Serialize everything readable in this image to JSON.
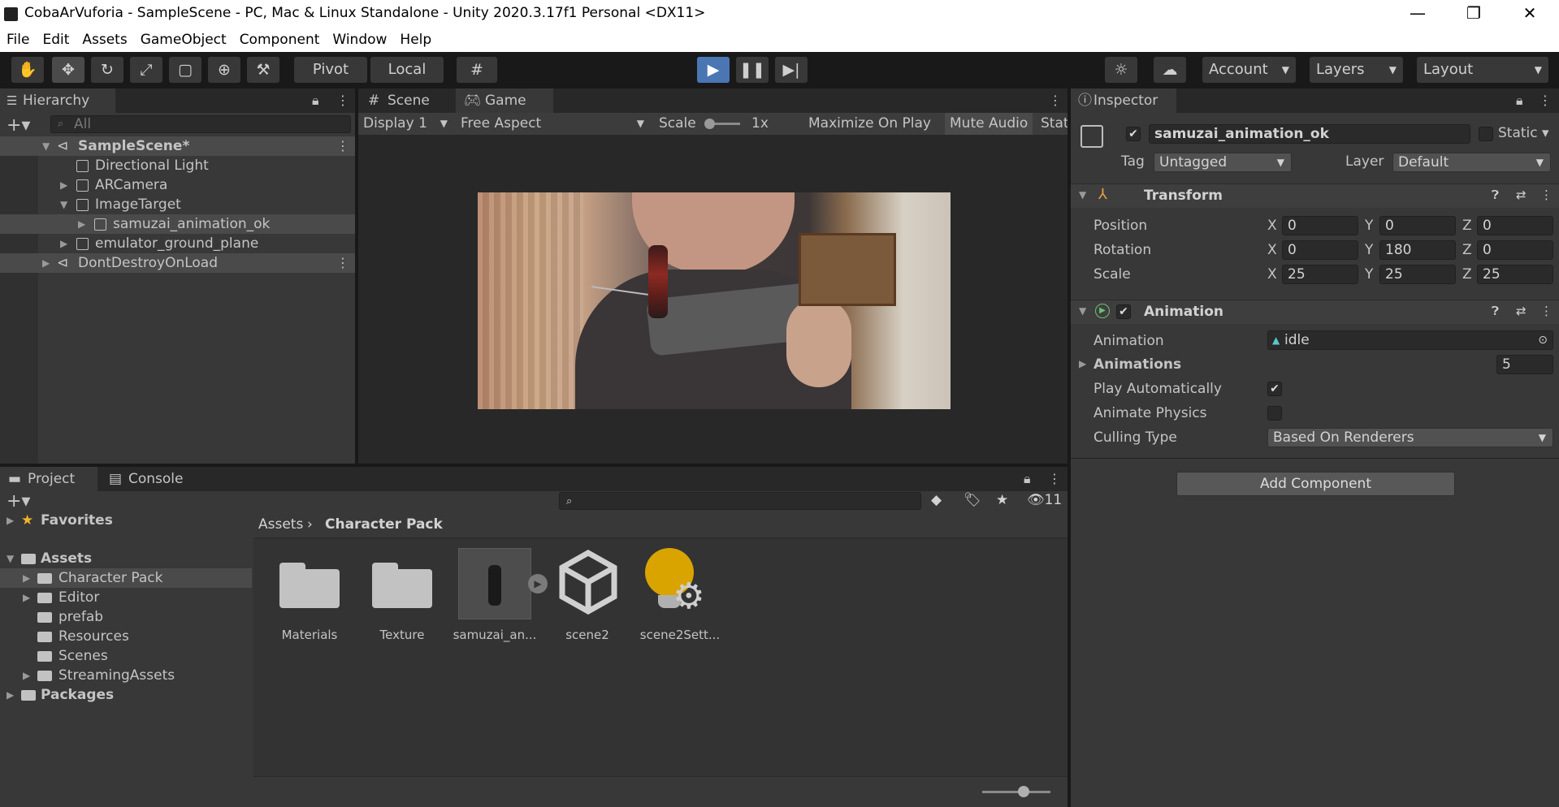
{
  "window": {
    "title": "CobaArVuforia - SampleScene - PC, Mac & Linux Standalone - Unity 2020.3.17f1 Personal <DX11>"
  },
  "menu": [
    "File",
    "Edit",
    "Assets",
    "GameObject",
    "Component",
    "Window",
    "Help"
  ],
  "toolbar": {
    "pivot": "Pivot",
    "local": "Local",
    "account": "Account",
    "layers": "Layers",
    "layout": "Layout"
  },
  "hierarchy": {
    "tab": "Hierarchy",
    "search_placeholder": "All",
    "items": [
      "SampleScene*",
      "Directional Light",
      "ARCamera",
      "ImageTarget",
      "samuzai_animation_ok",
      "emulator_ground_plane",
      "DontDestroyOnLoad"
    ]
  },
  "game": {
    "tabs": [
      "Scene",
      "Game"
    ],
    "display": "Display 1",
    "aspect": "Free Aspect",
    "scale_label": "Scale",
    "scale_value": "1x",
    "maximize": "Maximize On Play",
    "mute": "Mute Audio",
    "stats": "Stat"
  },
  "inspector": {
    "tab": "Inspector",
    "object_name": "samuzai_animation_ok",
    "static": "Static",
    "tag_label": "Tag",
    "tag_value": "Untagged",
    "layer_label": "Layer",
    "layer_value": "Default",
    "transform": {
      "title": "Transform",
      "position_label": "Position",
      "rotation_label": "Rotation",
      "scale_label": "Scale",
      "position": [
        "0",
        "0",
        "0"
      ],
      "rotation": [
        "0",
        "180",
        "0"
      ],
      "scale": [
        "25",
        "25",
        "25"
      ],
      "axes": [
        "X",
        "Y",
        "Z"
      ]
    },
    "animation": {
      "title": "Animation",
      "animation_label": "Animation",
      "animation_value": "idle",
      "animations_label": "Animations",
      "animations_count": "5",
      "play_auto_label": "Play Automatically",
      "animate_physics_label": "Animate Physics",
      "culling_label": "Culling Type",
      "culling_value": "Based On Renderers"
    },
    "add_component": "Add Component"
  },
  "project": {
    "tabs": [
      "Project",
      "Console"
    ],
    "hidden_count": "11",
    "tree": [
      "Favorites",
      "Assets",
      "Character Pack",
      "Editor",
      "prefab",
      "Resources",
      "Scenes",
      "StreamingAssets",
      "Packages"
    ],
    "breadcrumb": [
      "Assets",
      "Character Pack"
    ],
    "assets": [
      "Materials",
      "Texture",
      "samuzai_an...",
      "scene2",
      "scene2Sett..."
    ]
  }
}
